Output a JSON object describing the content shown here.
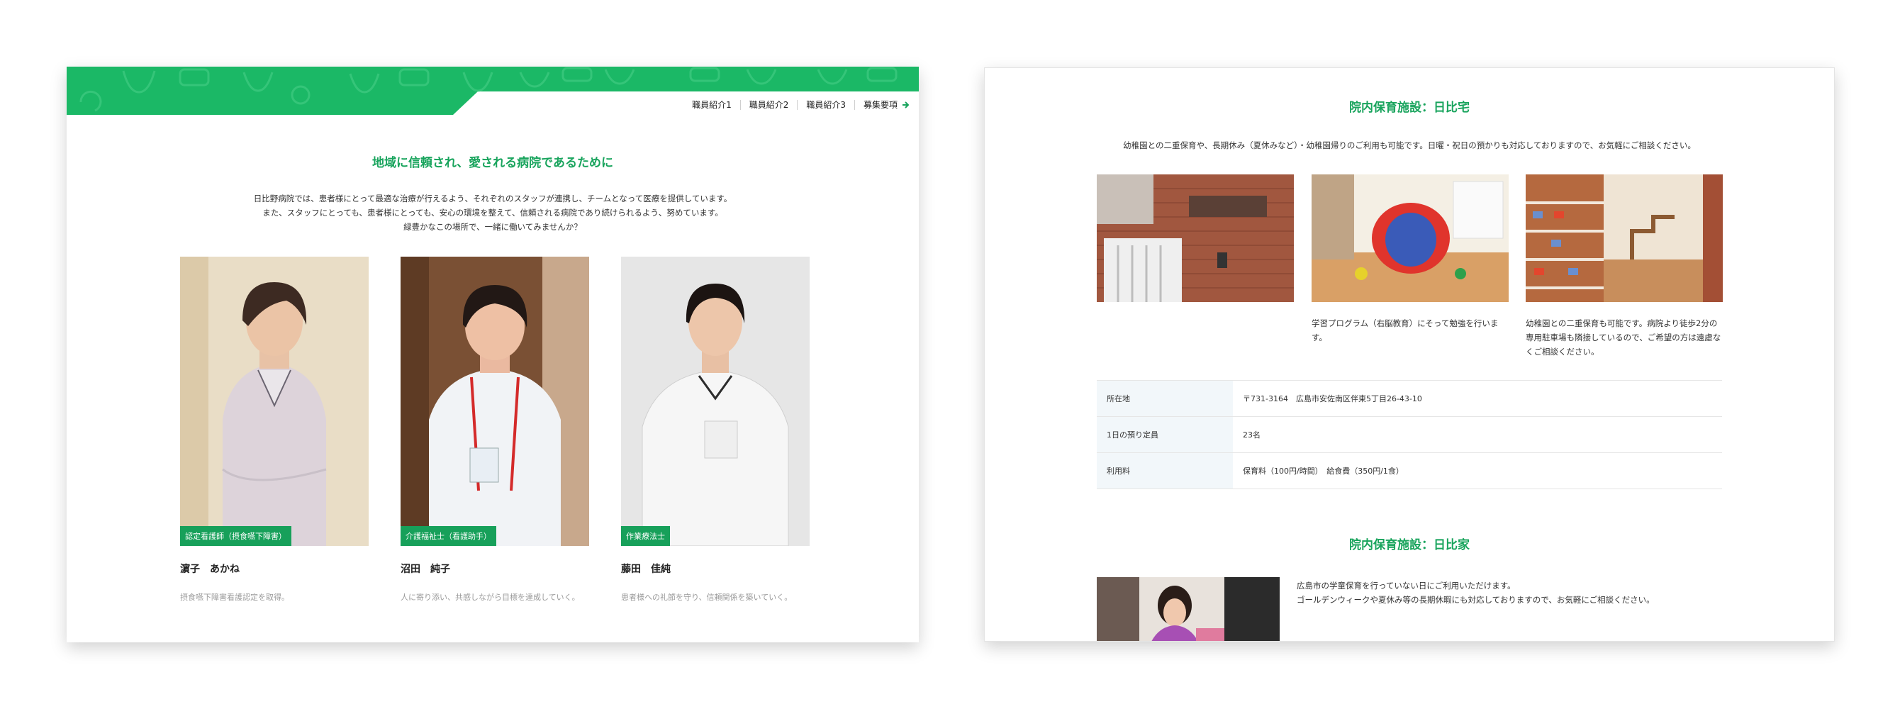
{
  "left_page": {
    "nav": [
      "職員紹介1",
      "職員紹介2",
      "職員紹介3"
    ],
    "nav_recruit": "募集要項",
    "heading": "地域に信頼され、愛される病院であるために",
    "intro_lines": [
      "日比野病院では、患者様にとって最適な治療が行えるよう、それぞれのスタッフが連携し、チームとなって医療を提供しています。",
      "また、スタッフにとっても、患者様にとっても、安心の環境を整えて、信頼される病院であり続けられるよう、努めています。",
      "緑豊かなこの場所で、一緒に働いてみませんか？"
    ],
    "staff": [
      {
        "role": "認定看護師（摂食嚥下障害）",
        "name": "濵子　あかね",
        "desc": "摂食嚥下障害看護認定を取得。"
      },
      {
        "role": "介護福祉士（看護助手）",
        "name": "沼田　純子",
        "desc": "人に寄り添い、共感しながら目標を達成していく。"
      },
      {
        "role": "作業療法士",
        "name": "藤田　佳純",
        "desc": "患者様への礼節を守り、信頼関係を築いていく。"
      }
    ]
  },
  "right_page": {
    "facility1": {
      "title": "院内保育施設：日比宅",
      "intro": "幼稚園との二重保育や、長期休み（夏休みなど）・幼稚園帰りのご利用も可能です。日曜・祝日の預かりも対応しておりますので、お気軽にご相談ください。",
      "captions": [
        "",
        "学習プログラム（右脳教育）にそって勉強を行います。",
        "幼稚園との二重保育も可能です。病院より徒歩2分の専用駐車場も隣接しているので、ご希望の方は遠慮なくご相談ください。"
      ],
      "table": [
        {
          "label": "所在地",
          "value": "〒731-3164　広島市安佐南区伴東5丁目26-43-10"
        },
        {
          "label": "1日の預り定員",
          "value": "23名"
        },
        {
          "label": "利用料",
          "value": "保育料（100円/時間）　給食費（350円/1食）"
        }
      ]
    },
    "facility2": {
      "title": "院内保育施設：日比家",
      "lines": [
        "広島市の学童保育を行っていない日にご利用いただけます。",
        "ゴールデンウィークや夏休み等の長期休暇にも対応しておりますので、お気軽にご相談ください。"
      ]
    }
  },
  "colors": {
    "brand_green": "#19a45d",
    "badge_green": "#17a05a",
    "table_label_bg": "#f2f7fa"
  }
}
